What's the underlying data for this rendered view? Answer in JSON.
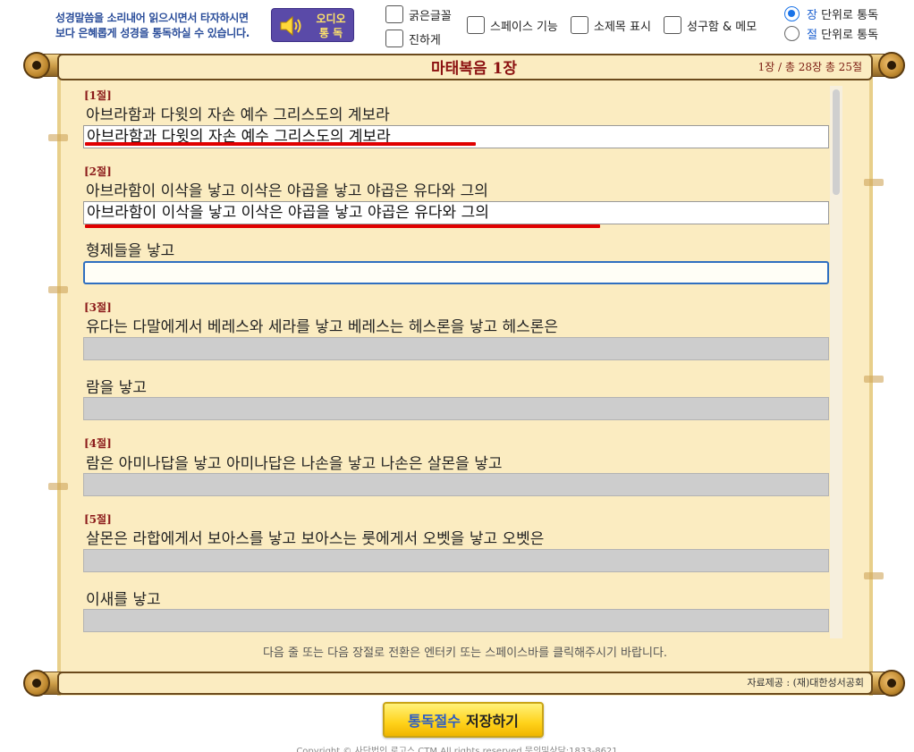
{
  "toolbar": {
    "promo_line1": "성경말씀을 소리내어 읽으시면서 타자하시면",
    "promo_line2": "보다 은혜롭게 성경을 통독하실 수 있습니다.",
    "audio_label_1": "오디오",
    "audio_label_2": "통  독",
    "bold_font_label": "굵은글꼴",
    "darker_label": "진하게",
    "space_label": "스페이스 기능",
    "subtitle_label": "소제목 표시",
    "memo_label": "성구함 & 메모",
    "radio_chapter_key": "장",
    "radio_chapter_rest": " 단위로 통독",
    "radio_verse_key": "절",
    "radio_verse_rest": " 단위로 통독",
    "selected_mode": "chapter"
  },
  "header": {
    "title": "마태복음 1장",
    "info": "1장 / 총 28장   총 25절"
  },
  "verses": [
    {
      "number": "[1절]",
      "lines": [
        {
          "text": "아브라함과 다윗의 자손 예수 그리스도의 계보라",
          "typed": "아브라함과 다윗의 자손 예수 그리스도의 계보라",
          "state": "done"
        }
      ]
    },
    {
      "number": "[2절]",
      "lines": [
        {
          "text": "아브라함이 이삭을 낳고 이삭은 야곱을 낳고 야곱은 유다와 그의",
          "typed": "아브라함이 이삭을 낳고 이삭은 야곱을 낳고 야곱은 유다와 그의",
          "state": "done"
        },
        {
          "text": "형제들을 낳고",
          "typed": "",
          "state": "active"
        }
      ]
    },
    {
      "number": "[3절]",
      "lines": [
        {
          "text": "유다는 다말에게서 베레스와 세라를 낳고 베레스는 헤스론을 낳고 헤스론은",
          "typed": "",
          "state": "disabled"
        },
        {
          "text": "람을 낳고",
          "typed": "",
          "state": "disabled"
        }
      ]
    },
    {
      "number": "[4절]",
      "lines": [
        {
          "text": "람은 아미나답을 낳고 아미나답은 나손을 낳고 나손은 살몬을 낳고",
          "typed": "",
          "state": "disabled"
        }
      ]
    },
    {
      "number": "[5절]",
      "lines": [
        {
          "text": "살몬은 라합에게서 보아스를 낳고 보아스는 룻에게서 오벳을 낳고 오벳은",
          "typed": "",
          "state": "disabled"
        },
        {
          "text": "이새를 낳고",
          "typed": "",
          "state": "disabled"
        }
      ]
    }
  ],
  "footer": {
    "hint": "다음 줄 또는 다음 장절로 전환은 엔터키 또는 스페이스바를 클릭해주시기 바랍니다.",
    "source": "자료제공 : (재)대한성서공회",
    "save_label_a": "통독절수",
    "save_label_b": "저장하기",
    "copyright": "Copyright © 사단법인 로고스 CTM All rights reserved 문의및상담:1833-8621"
  },
  "colors": {
    "parchment": "#fbecc1",
    "title_red": "#8b1010",
    "underline_red": "#e00000",
    "accent_blue": "#1a73e8"
  }
}
